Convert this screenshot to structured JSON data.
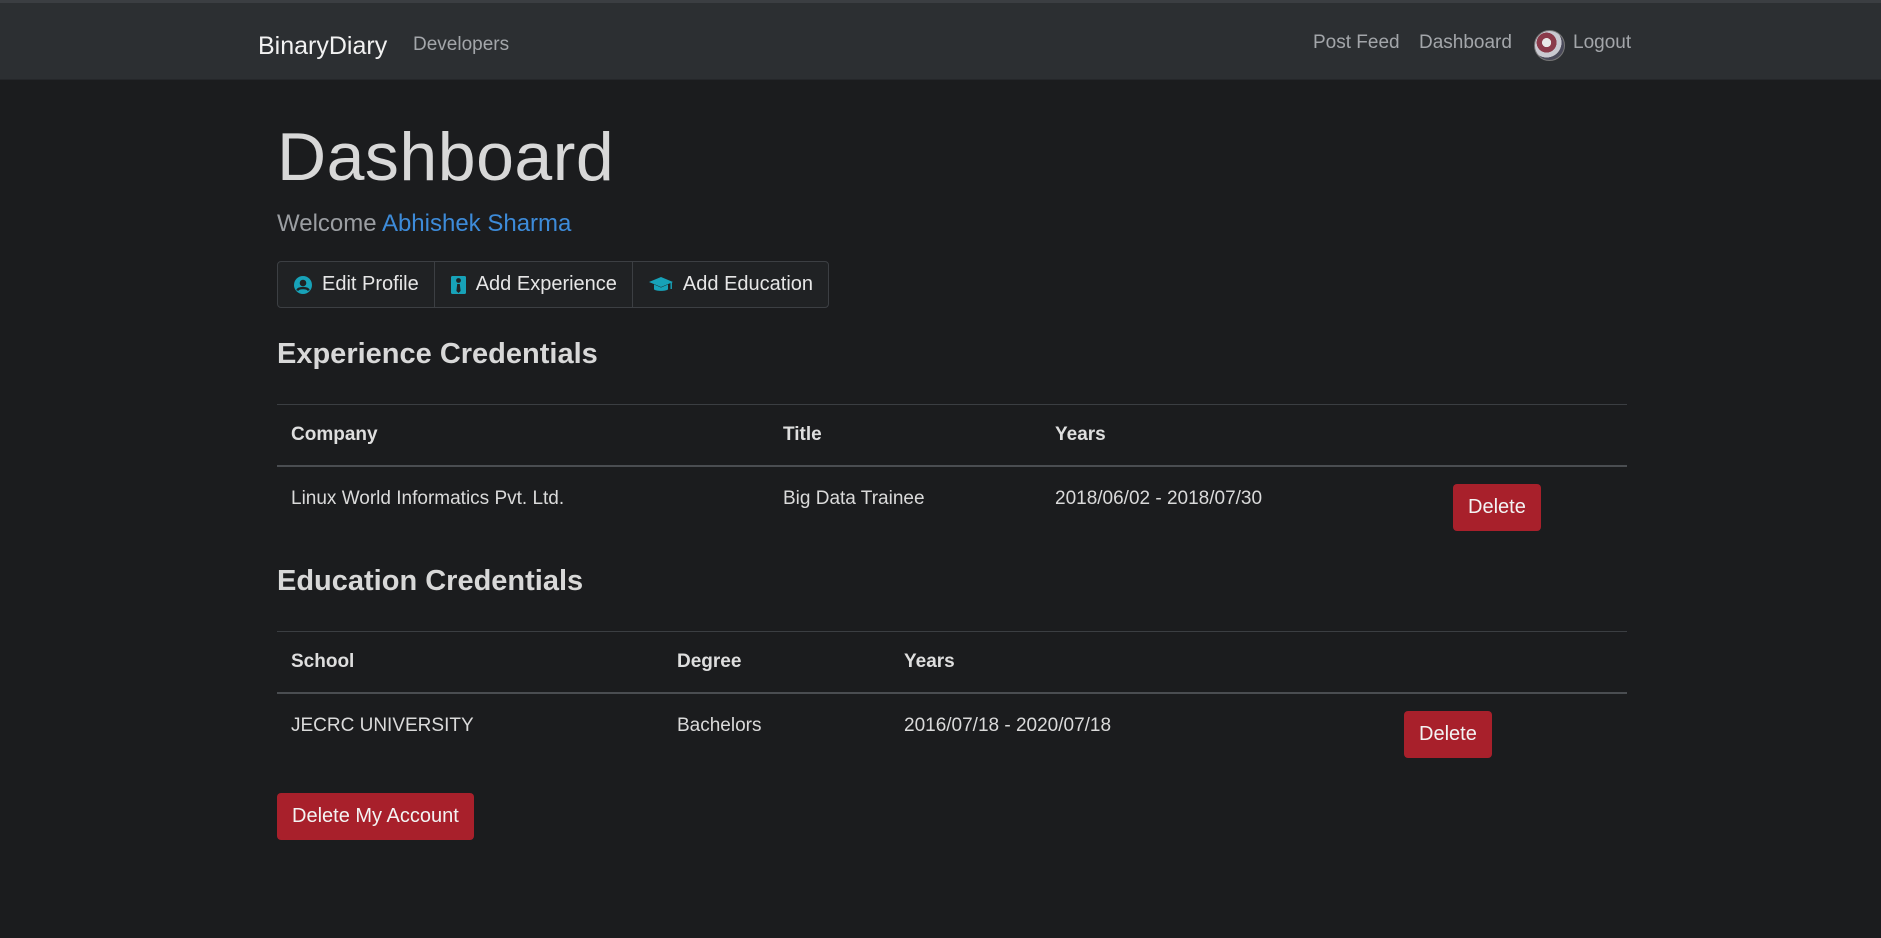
{
  "navbar": {
    "brand": "BinaryDiary",
    "developers": "Developers",
    "post_feed": "Post Feed",
    "dashboard": "Dashboard",
    "logout": "Logout"
  },
  "page": {
    "title": "Dashboard",
    "welcome_prefix": "Welcome",
    "user_name": "Abhishek Sharma"
  },
  "actions": {
    "edit_profile": "Edit Profile",
    "add_experience": "Add Experience",
    "add_education": "Add Education"
  },
  "experience": {
    "heading": "Experience Credentials",
    "columns": [
      "Company",
      "Title",
      "Years"
    ],
    "rows": [
      {
        "company": "Linux World Informatics Pvt. Ltd.",
        "title": "Big Data Trainee",
        "years": "2018/06/02 - 2018/07/30",
        "delete": "Delete"
      }
    ]
  },
  "education": {
    "heading": "Education Credentials",
    "columns": [
      "School",
      "Degree",
      "Years"
    ],
    "rows": [
      {
        "school": "JECRC UNIVERSITY",
        "degree": "Bachelors",
        "years": "2016/07/18 - 2020/07/18",
        "delete": "Delete"
      }
    ]
  },
  "delete_account": "Delete My Account",
  "colors": {
    "background": "#1b1c1e",
    "navbar": "#2c2f32",
    "link": "#3d8bd9",
    "danger": "#a8202b",
    "icon": "#17a2b8"
  },
  "icons": {
    "edit_profile": "user-circle-icon",
    "add_experience": "user-tie-icon",
    "add_education": "graduation-cap-icon",
    "avatar": "avatar"
  }
}
